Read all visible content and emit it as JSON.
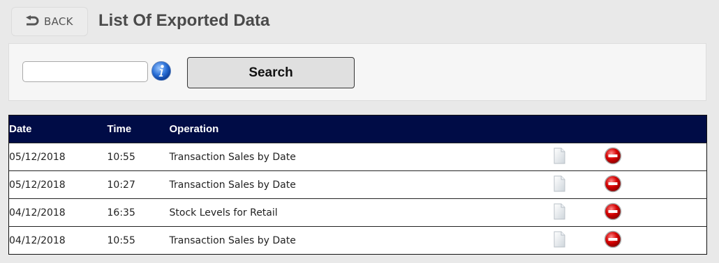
{
  "header": {
    "back_label": "BACK",
    "title": "List Of Exported Data"
  },
  "search": {
    "value": "",
    "button_label": "Search"
  },
  "table": {
    "columns": [
      "Date",
      "Time",
      "Operation",
      "",
      ""
    ],
    "rows": [
      {
        "date": "05/12/2018",
        "time": "10:55",
        "operation": "Transaction Sales by Date"
      },
      {
        "date": "05/12/2018",
        "time": "10:27",
        "operation": "Transaction Sales by Date"
      },
      {
        "date": "04/12/2018",
        "time": "16:35",
        "operation": "Stock Levels for Retail"
      },
      {
        "date": "04/12/2018",
        "time": "10:55",
        "operation": "Transaction Sales by Date"
      }
    ]
  },
  "icons": {
    "back": "back-arrow-icon",
    "info": "info-icon",
    "document": "document-icon",
    "delete": "delete-icon"
  },
  "colors": {
    "header_bg": "#000c46",
    "page_bg": "#e9e9e9",
    "delete_red": "#d40000",
    "info_blue": "#2a6fd6"
  }
}
